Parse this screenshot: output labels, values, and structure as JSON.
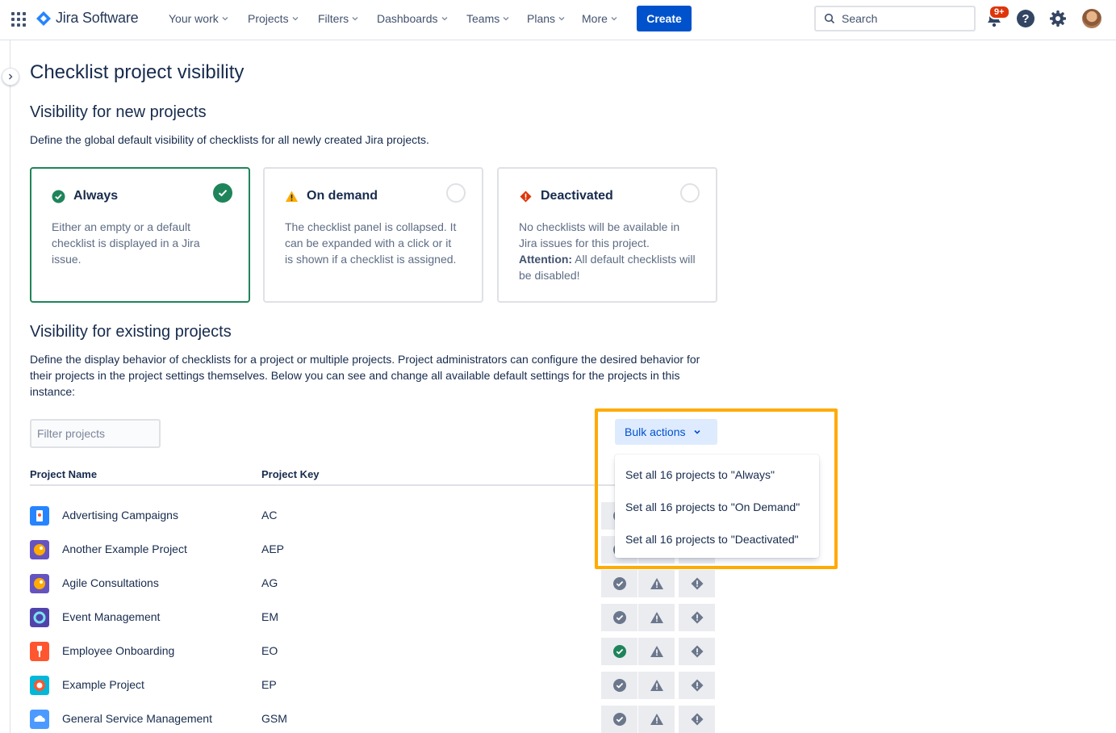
{
  "nav": {
    "logo": "Jira Software",
    "items": [
      "Your work",
      "Projects",
      "Filters",
      "Dashboards",
      "Teams",
      "Plans",
      "More"
    ],
    "create_label": "Create",
    "search_placeholder": "Search",
    "notification_badge": "9+",
    "help_label": "?"
  },
  "page": {
    "title": "Checklist project visibility",
    "new_heading": "Visibility for new projects",
    "new_desc": "Define the global default visibility of checklists for all newly created Jira projects.",
    "existing_heading": "Visibility for existing projects",
    "existing_desc": "Define the display behavior of checklists for a project or multiple projects. Project administrators can configure the desired behavior for their projects in the project settings themselves. Below you can see and change all available default settings for the projects in this instance:"
  },
  "cards": [
    {
      "title": "Always",
      "desc": "Either an empty or a default checklist is displayed in a Jira issue.",
      "selected": true
    },
    {
      "title": "On demand",
      "desc": "The checklist panel is collapsed. It can be expanded with a click or it is shown if a checklist is assigned.",
      "selected": false
    },
    {
      "title": "Deactivated",
      "desc_prefix": "No checklists will be available in Jira issues for this project. ",
      "desc_bold": "Attention:",
      "desc_suffix": " All default checklists will be disabled!",
      "selected": false
    }
  ],
  "filter": {
    "placeholder": "Filter projects"
  },
  "table": {
    "headers": [
      "Project Name",
      "Project Key"
    ],
    "rows": [
      {
        "name": "Advertising Campaigns",
        "key": "AC",
        "state": "unknown"
      },
      {
        "name": "Another Example Project",
        "key": "AEP",
        "state": "unknown"
      },
      {
        "name": "Agile Consultations",
        "key": "AG",
        "state": "none"
      },
      {
        "name": "Event Management",
        "key": "EM",
        "state": "none"
      },
      {
        "name": "Employee Onboarding",
        "key": "EO",
        "state": "always"
      },
      {
        "name": "Example Project",
        "key": "EP",
        "state": "none"
      },
      {
        "name": "General Service Management",
        "key": "GSM",
        "state": "none"
      }
    ]
  },
  "bulk": {
    "label": "Bulk actions",
    "items": [
      "Set all 16 projects to \"Always\"",
      "Set all 16 projects to \"On Demand\"",
      "Set all 16 projects to \"Deactivated\""
    ]
  },
  "colors": {
    "accent": "#0052cc",
    "success": "#1f845a",
    "warning": "#ffab00",
    "danger": "#de350b"
  }
}
